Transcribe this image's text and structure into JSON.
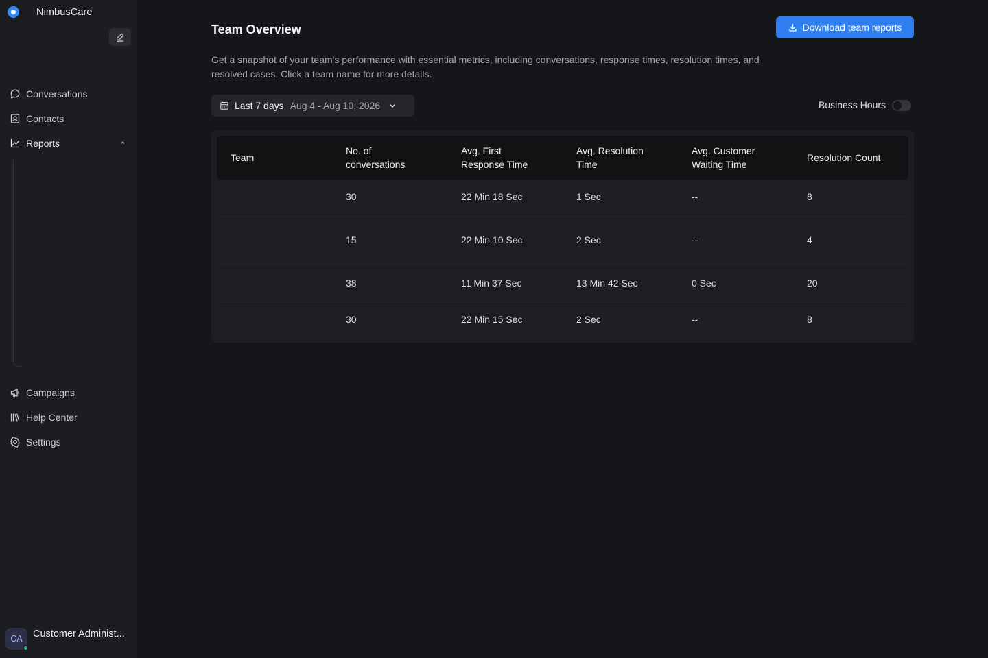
{
  "brand": {
    "name": "NimbusCare"
  },
  "sidebar": {
    "items": [
      {
        "label": "Conversations",
        "icon": "chat-bubble-icon"
      },
      {
        "label": "Contacts",
        "icon": "contact-card-icon"
      },
      {
        "label": "Reports",
        "icon": "line-chart-icon",
        "expanded": true
      },
      {
        "label": "Campaigns",
        "icon": "megaphone-icon"
      },
      {
        "label": "Help Center",
        "icon": "library-icon"
      },
      {
        "label": "Settings",
        "icon": "gear-icon"
      }
    ]
  },
  "user": {
    "initials": "CA",
    "name": "Customer Administ...",
    "status": "online"
  },
  "header": {
    "title": "Team Overview",
    "download_label": "Download team reports",
    "description": "Get a snapshot of your team's performance with essential metrics, including conversations, response times, resolution times, and resolved cases. Click a team name for more details."
  },
  "filters": {
    "range_label": "Last 7 days",
    "range_dates": "Aug 4 - Aug 10, 2026",
    "business_hours_label": "Business Hours",
    "business_hours_enabled": false
  },
  "table": {
    "columns": [
      "Team",
      "No. of\nconversations",
      "Avg. First\nResponse Time",
      "Avg. Resolution\nTime",
      "Avg. Customer\nWaiting Time",
      "Resolution Count"
    ],
    "rows": [
      [
        "",
        "30",
        "22 Min 18 Sec",
        "1 Sec",
        "--",
        "8"
      ],
      [
        "",
        "15",
        "22 Min 10 Sec",
        "2 Sec",
        "--",
        "4"
      ],
      [
        "",
        "38",
        "11 Min 37 Sec",
        "13 Min 42 Sec",
        "0 Sec",
        "20"
      ],
      [
        "",
        "30",
        "22 Min 15 Sec",
        "2 Sec",
        "--",
        "8"
      ]
    ]
  },
  "colors": {
    "accent": "#2f7ff1",
    "background": "#151619",
    "sidebar": "#1c1d21",
    "online": "#2ec27e"
  }
}
